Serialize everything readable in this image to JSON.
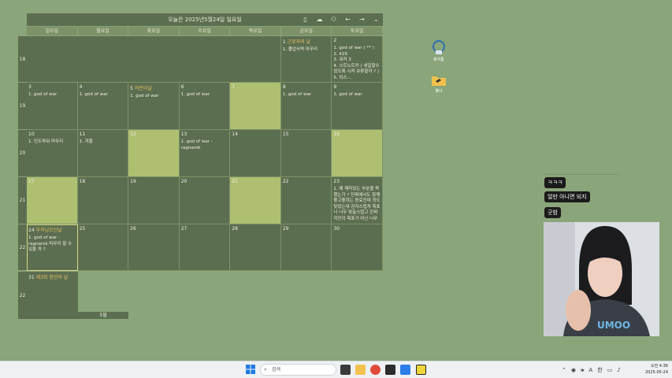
{
  "calendar": {
    "header_title": "오늘은 2025년5월24일 일요일",
    "days_of_week": [
      "일요일",
      "월요일",
      "화요일",
      "수요일",
      "목요일",
      "금요일",
      "토요일"
    ],
    "week_numbers": [
      "18",
      "19",
      "20",
      "21",
      "22"
    ],
    "cells": [
      {
        "date": "1",
        "holiday": "근로자의 날",
        "events": [
          "1. 졸업사역 마무리"
        ]
      },
      {
        "date": "2",
        "holiday": "",
        "events": [
          "1. god of war ( ** )",
          "2. 429",
          "3. 워커 3",
          "4. 스트노트카 ( 세일할수 있도록 시켜 보류할까 ? )",
          "5. 이스..."
        ]
      },
      {
        "date": "3",
        "holiday": "",
        "events": [
          "1. god of war"
        ]
      },
      {
        "date": "4",
        "holiday": "",
        "events": [
          "1. god of war"
        ]
      },
      {
        "date": "5",
        "holiday": "어린이날",
        "events": [
          "1. god of war"
        ]
      },
      {
        "date": "6",
        "holiday": "",
        "events": [
          "1. god of war"
        ]
      },
      {
        "date": "7",
        "holiday": "",
        "events": []
      },
      {
        "date": "8",
        "holiday": "",
        "events": [
          "1. god of war"
        ]
      },
      {
        "date": "9",
        "holiday": "",
        "events": [
          "1. god of war"
        ]
      },
      {
        "date": "10",
        "holiday": "",
        "events": [
          "1. 인도파워 마무리"
        ]
      },
      {
        "date": "11",
        "holiday": "",
        "events": [
          "1. 겨울"
        ]
      },
      {
        "date": "12",
        "holiday": "",
        "events": []
      },
      {
        "date": "13",
        "holiday": "",
        "events": [
          "1. god of war - ragnarok"
        ]
      },
      {
        "date": "14",
        "holiday": "",
        "events": []
      },
      {
        "date": "15",
        "holiday": "",
        "events": []
      },
      {
        "date": "16",
        "holiday": "",
        "events": []
      },
      {
        "date": "17",
        "holiday": "",
        "events": []
      },
      {
        "date": "18",
        "holiday": "",
        "events": []
      },
      {
        "date": "19",
        "holiday": "",
        "events": []
      },
      {
        "date": "20",
        "holiday": "",
        "events": []
      },
      {
        "date": "21",
        "holiday": "",
        "events": []
      },
      {
        "date": "22",
        "holiday": "",
        "events": []
      },
      {
        "date": "23",
        "holiday": "",
        "events": [
          "1. 왜 재미있는 부분을 쭉 했는가 ? 진짜에서도 함께 좋고좋하는 동료인데 정도 맞았는데 감자스럽게 목표니 너무 맞출스럽고 진짜 지인이 목표가 아닌 너무"
        ]
      },
      {
        "date": "24",
        "holiday": "부처님오신날",
        "events": [
          "1. god of war - ragnarok 마무리 할 수 있을 까 ?"
        ]
      },
      {
        "date": "25",
        "holiday": "",
        "events": []
      },
      {
        "date": "26",
        "holiday": "",
        "events": []
      },
      {
        "date": "27",
        "holiday": "",
        "events": []
      },
      {
        "date": "28",
        "holiday": "",
        "events": []
      },
      {
        "date": "29",
        "holiday": "",
        "events": []
      },
      {
        "date": "30",
        "holiday": "",
        "events": []
      }
    ],
    "last_week_number": "22",
    "last_cell": {
      "date": "31",
      "holiday": "제3회 정선의 날"
    },
    "month_label": "5월"
  },
  "desktop_icons": [
    {
      "label": "휴지통",
      "icon": "recycle-bin-icon"
    },
    {
      "label": "폴더",
      "icon": "folder-icon"
    }
  ],
  "chat": {
    "messages": [
      "ㅋㅋㅋ",
      "얼만 아니면 되지",
      "굿밤"
    ]
  },
  "taskbar": {
    "search_placeholder": "검색",
    "tray_lang": "한",
    "clock_time": "오전 4:36",
    "clock_date": "2025-05-24"
  },
  "colors": {
    "desktop": "#8aa57a",
    "cell_dark": "#5c6e50",
    "cell_light": "#aebf72",
    "holiday_text": "#e8c266"
  }
}
